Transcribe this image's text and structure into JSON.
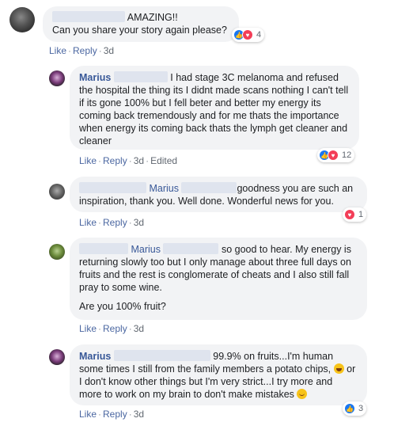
{
  "comments": [
    {
      "text_lines": [
        "AMAZING!!",
        "Can you share your story again please?"
      ],
      "reactions": {
        "count": "4"
      },
      "actions": {
        "like": "Like",
        "reply": "Reply",
        "time": "3d"
      }
    },
    {
      "author": "Marius",
      "text": "I had stage 3C melanoma and refused the hospital the thing its I didnt made scans nothing I can't tell if its gone 100% but I fell beter and better my energy its coming back tremendously and for me thats the importance when energy its coming back thats the lymph get cleaner and cleaner",
      "reactions": {
        "count": "12"
      },
      "actions": {
        "like": "Like",
        "reply": "Reply",
        "time": "3d",
        "edited": "Edited"
      }
    },
    {
      "tag": "Marius",
      "text": "goodness you are such an inspiration, thank you. Well done. Wonderful news for you.",
      "reactions": {
        "count": "1"
      },
      "actions": {
        "like": "Like",
        "reply": "Reply",
        "time": "3d"
      }
    },
    {
      "tag": "Marius",
      "text": "so good to hear. My energy is returning slowly too but I only manage about three full days on fruits and the rest is conglomerate of cheats and I also still fall pray to some wine.",
      "text2": "Are you 100% fruit?",
      "actions": {
        "like": "Like",
        "reply": "Reply",
        "time": "3d"
      }
    },
    {
      "author": "Marius",
      "text": "99.9% on fruits...I'm human some times I still from the family members a potato chips,",
      "text_b": "or I don't know other things but I'm very strict...I try more and more to work on my brain to don't make mistakes",
      "reactions": {
        "count": "3"
      },
      "actions": {
        "like": "Like",
        "reply": "Reply",
        "time": "3d"
      }
    }
  ],
  "icons": {
    "like": "thumbs-up-icon",
    "love": "heart-icon",
    "laugh": "laughing-emoji",
    "smile": "smiling-emoji"
  },
  "colors": {
    "link": "#385898",
    "bubble": "#f2f3f5",
    "like_blue": "#1877f2",
    "love_red": "#f33e58"
  }
}
